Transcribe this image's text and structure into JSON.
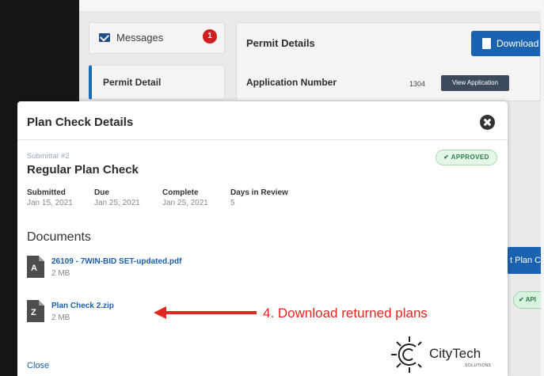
{
  "background": {
    "sidebar": {
      "messages_label": "Messages",
      "messages_count": "1",
      "permit_detail_label": "Permit Detail"
    },
    "main": {
      "title": "Permit Details",
      "download_label": "Download",
      "application_number_label": "Application Number",
      "application_number_value": "1304",
      "view_application_label": "View Application",
      "peek_plan_label": "t Plan C",
      "peek_badge_label": "✔ API"
    }
  },
  "modal": {
    "title": "Plan Check Details",
    "submittal_number": "Submittal #2",
    "status_badge": "✔ APPROVED",
    "submittal_type": "Regular Plan Check",
    "meta": [
      {
        "label": "Submitted",
        "value": "Jan 15, 2021"
      },
      {
        "label": "Due",
        "value": "Jan 25, 2021"
      },
      {
        "label": "Complete",
        "value": "Jan 25, 2021"
      },
      {
        "label": "Days in Review",
        "value": "5"
      }
    ],
    "documents_heading": "Documents",
    "documents": [
      {
        "name": "26109 - 7WIN-BID SET-updated.pdf",
        "size": "2 MB",
        "icon": "pdf-file-icon"
      },
      {
        "name": "Plan Check 2.zip",
        "size": "2 MB",
        "icon": "zip-file-icon"
      }
    ],
    "close_label": "Close"
  },
  "annotation": {
    "text": "4.  Download returned plans",
    "color": "#e0261f"
  },
  "logo": {
    "name": "CityTech",
    "tagline": "SOLUTIONS"
  },
  "colors": {
    "link": "#1b5ea6",
    "primary_button": "#1b63b0",
    "approved_bg": "#e3f6e7",
    "approved_text": "#2f7d46"
  }
}
